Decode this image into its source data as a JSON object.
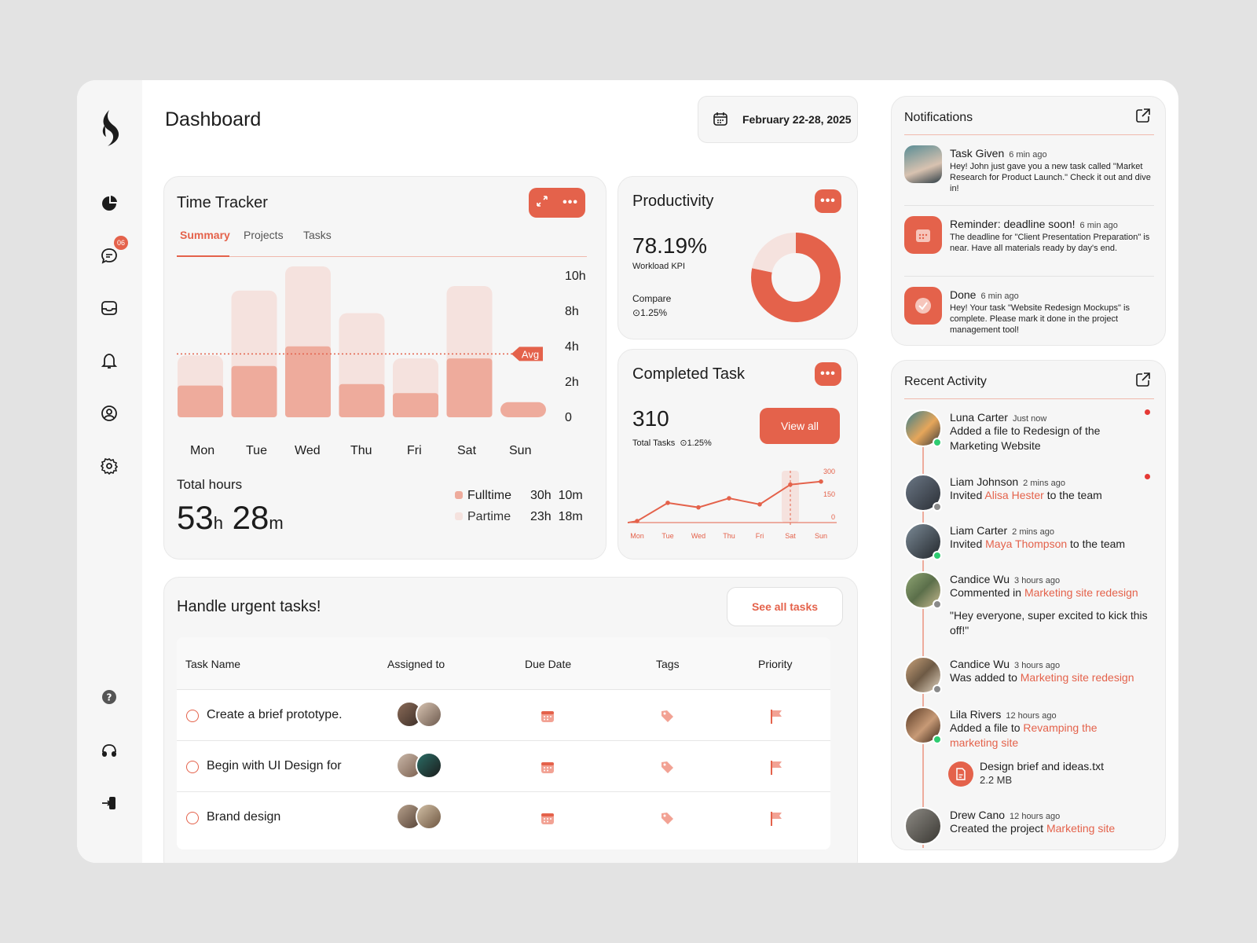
{
  "header": {
    "title": "Dashboard",
    "date_range": "February 22-28, 2025"
  },
  "sidebar": {
    "badge": "06",
    "icons": [
      "pie-chart-icon",
      "chat-icon",
      "inbox-icon",
      "bell-icon",
      "user-circle-icon",
      "gear-icon",
      "help-icon",
      "headset-icon",
      "logout-icon"
    ]
  },
  "colors": {
    "accent": "#e4624b",
    "light_accent": "#eeab9c",
    "pale_accent": "#f5e2de",
    "background": "#f6f6f6"
  },
  "time_tracker": {
    "title": "Time Tracker",
    "tabs": [
      "Summary",
      "Projects",
      "Tasks"
    ],
    "active_tab": "Summary",
    "avg_label": "Avg",
    "total_label": "Total hours",
    "total_hours": "53",
    "total_minutes": "28",
    "hours_unit": "h",
    "minutes_unit": "m",
    "legend": [
      {
        "name": "Fulltime",
        "hours": "30h",
        "minutes": "10m"
      },
      {
        "name": "Partime",
        "hours": "23h",
        "minutes": "18m"
      }
    ]
  },
  "chart_data": [
    {
      "type": "bar",
      "title": "Time Tracker",
      "categories": [
        "Mon",
        "Tue",
        "Wed",
        "Thu",
        "Fri",
        "Sat",
        "Sun"
      ],
      "y_tick_labels": [
        "10h",
        "8h",
        "4h",
        "2h",
        "0"
      ],
      "series": [
        {
          "name": "Fulltime",
          "values": [
            0.21,
            0.34,
            0.47,
            0.22,
            0.16,
            0.39,
            0.1
          ]
        },
        {
          "name": "Partime",
          "values": [
            0.2,
            0.5,
            0.53,
            0.47,
            0.23,
            0.48,
            0
          ]
        }
      ],
      "avg_level": 0.42,
      "legend": "bottom-right"
    },
    {
      "type": "pie",
      "title": "Productivity",
      "slices": [
        {
          "value": 78.19
        },
        {
          "value": 21.81
        }
      ]
    },
    {
      "type": "line",
      "title": "Completed Task",
      "categories": [
        "Mon",
        "Tue",
        "Wed",
        "Thu",
        "Fri",
        "Sat",
        "Sun"
      ],
      "y_tick_labels": [
        "300",
        "150",
        "0"
      ],
      "values": [
        10,
        130,
        100,
        160,
        120,
        250,
        270
      ],
      "highlight": "Sat",
      "ylim": [
        0,
        300
      ]
    }
  ],
  "productivity": {
    "title": "Productivity",
    "value": "78.19%",
    "kpi_label": "Workload KPI",
    "compare_label": "Compare",
    "compare_value": "1.25%"
  },
  "completed": {
    "title": "Completed Task",
    "value": "310",
    "label": "Total Tasks",
    "change": "1.25%",
    "button": "View all"
  },
  "urgent": {
    "title": "Handle urgent tasks!",
    "button": "See all tasks",
    "columns": [
      "Task Name",
      "Assigned to",
      "Due Date",
      "Tags",
      "Priority"
    ],
    "rows": [
      {
        "name": "Create a brief prototype."
      },
      {
        "name": "Begin with UI Design for"
      },
      {
        "name": "Brand design"
      }
    ]
  },
  "notifications": {
    "title": "Notifications",
    "items": [
      {
        "title": "Task Given",
        "time": "6 min ago",
        "body": "Hey! John just gave you a new task called \"Market Research for Product Launch.\" Check it out and dive in!"
      },
      {
        "title": "Reminder: deadline soon!",
        "time": "6 min ago",
        "body": "The deadline for \"Client Presentation Preparation\" is near. Have all materials ready by day's end."
      },
      {
        "title": "Done",
        "time": "6 min ago",
        "body": "Hey! Your task \"Website Redesign Mockups\" is complete. Please mark it done in the project management tool!"
      }
    ]
  },
  "activity": {
    "title": "Recent Activity",
    "items": [
      {
        "name": "Luna Carter",
        "time": "Just now",
        "pre": "Added a file to Redesign of the Marketing Website",
        "link": "",
        "post": ""
      },
      {
        "name": "Liam Johnson",
        "time": "2 mins ago",
        "pre": "Invited ",
        "link": "Alisa Hester",
        "post": " to the team"
      },
      {
        "name": "Liam Carter",
        "time": "2 mins ago",
        "pre": "Invited ",
        "link": "Maya Thompson",
        "post": " to the team"
      },
      {
        "name": "Candice Wu",
        "time": "3 hours ago",
        "pre": "Commented in ",
        "link": "Marketing site redesign",
        "post": "",
        "quote": "\"Hey everyone, super excited to kick this off!\""
      },
      {
        "name": "Candice Wu",
        "time": "3 hours ago",
        "pre": "Was added to ",
        "link": "Marketing site redesign",
        "post": ""
      },
      {
        "name": "Lila Rivers",
        "time": "12 hours ago",
        "pre": "Added a file to ",
        "link": "Revamping the marketing site",
        "post": "",
        "file_name": "Design brief and ideas.txt",
        "file_size": "2.2 MB"
      },
      {
        "name": "Drew Cano",
        "time": "12 hours ago",
        "pre": "Created the project ",
        "link": "Marketing site",
        "post": ""
      }
    ]
  }
}
